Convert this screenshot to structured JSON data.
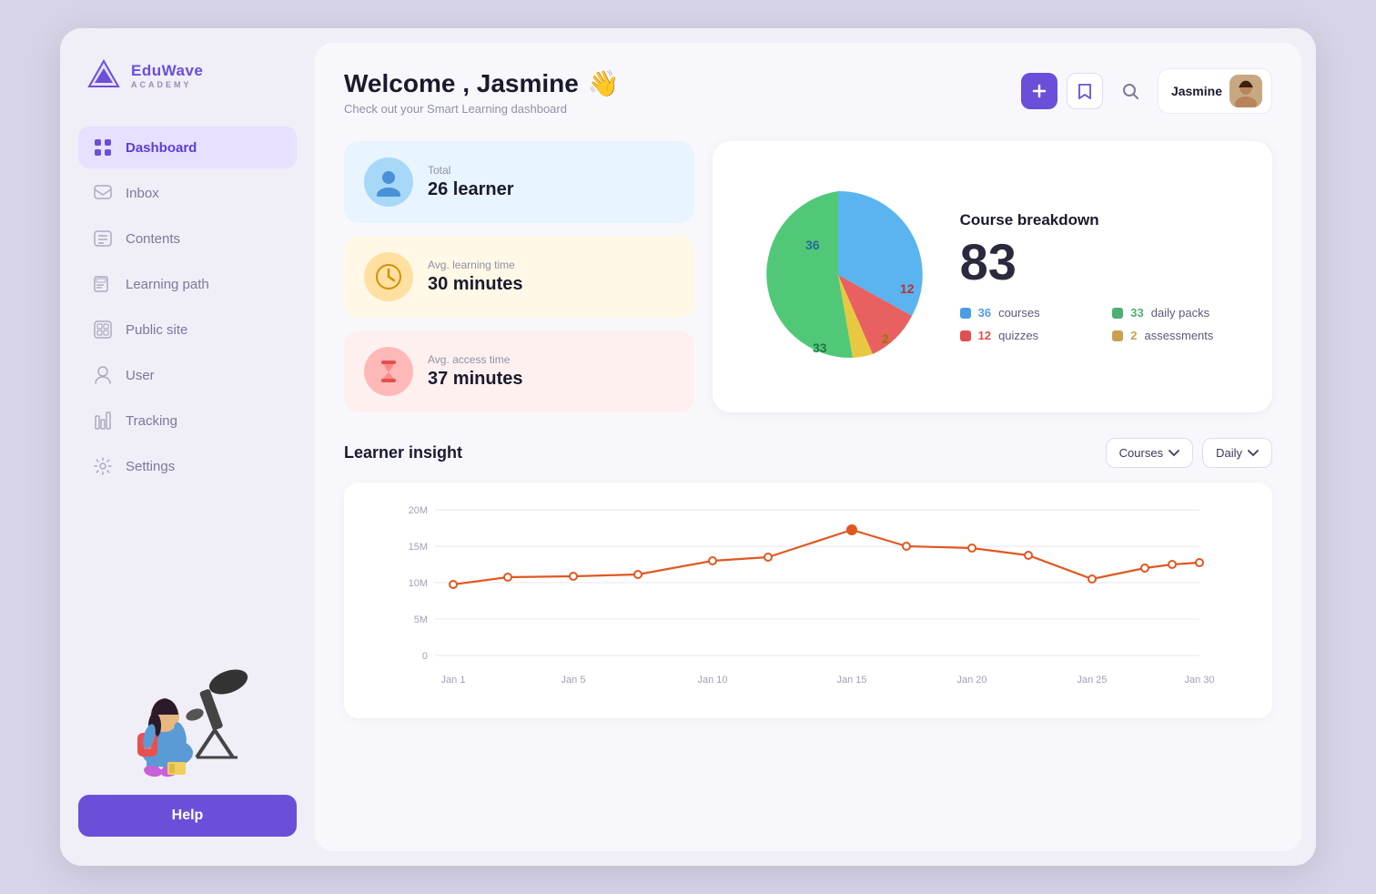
{
  "app": {
    "name": "EduWave",
    "subtitle": "ACADEMY"
  },
  "sidebar": {
    "nav_items": [
      {
        "id": "dashboard",
        "label": "Dashboard",
        "icon": "⊞",
        "active": true
      },
      {
        "id": "inbox",
        "label": "Inbox",
        "icon": "✉",
        "active": false
      },
      {
        "id": "contents",
        "label": "Contents",
        "icon": "☰",
        "active": false
      },
      {
        "id": "learning-path",
        "label": "Learning path",
        "icon": "📖",
        "active": false
      },
      {
        "id": "public-site",
        "label": "Public site",
        "icon": "⊡",
        "active": false
      },
      {
        "id": "user",
        "label": "User",
        "icon": "👤",
        "active": false
      },
      {
        "id": "tracking",
        "label": "Tracking",
        "icon": "📊",
        "active": false
      },
      {
        "id": "settings",
        "label": "Settings",
        "icon": "⚙",
        "active": false
      }
    ],
    "help_button": "Help"
  },
  "header": {
    "welcome": "Welcome , Jasmine",
    "welcome_emoji": "👋",
    "subtitle": "Check out your Smart Learning dashboard",
    "user_name": "Jasmine"
  },
  "stats": [
    {
      "label": "Total",
      "value": "26 learner",
      "color": "blue"
    },
    {
      "label": "Avg. learning time",
      "value": "30 minutes",
      "color": "yellow"
    },
    {
      "label": "Avg. access time",
      "value": "37 minutes",
      "color": "pink"
    }
  ],
  "breakdown": {
    "title": "Course breakdown",
    "total": "83",
    "legend": [
      {
        "label": "courses",
        "count": "36",
        "color": "#4b9de8"
      },
      {
        "label": "daily packs",
        "count": "33",
        "color": "#4caf74"
      },
      {
        "label": "quizzes",
        "count": "12",
        "color": "#e05050"
      },
      {
        "label": "assessments",
        "count": "2",
        "color": "#c8a050"
      }
    ],
    "pie": {
      "segments": [
        {
          "value": 36,
          "color": "#5ab4f0",
          "label": "36"
        },
        {
          "value": 12,
          "color": "#e86060",
          "label": "12"
        },
        {
          "value": 2,
          "color": "#e8c840",
          "label": "2"
        },
        {
          "value": 33,
          "color": "#50c878",
          "label": "33"
        }
      ]
    }
  },
  "learner_insight": {
    "title": "Learner insight",
    "filter_options": [
      "Courses",
      "Daily"
    ],
    "chart": {
      "y_labels": [
        "20M",
        "15M",
        "10M",
        "5M",
        "0"
      ],
      "x_labels": [
        "Jan 1",
        "Jan 5",
        "Jan 10",
        "Jan 15",
        "Jan 20",
        "Jan 25",
        "Jan 30"
      ],
      "data_points": [
        {
          "x": 0,
          "y": 9.8
        },
        {
          "x": 1,
          "y": 10.8
        },
        {
          "x": 2,
          "y": 10.9
        },
        {
          "x": 3,
          "y": 11.2
        },
        {
          "x": 4,
          "y": 13.0
        },
        {
          "x": 5,
          "y": 13.4
        },
        {
          "x": 6,
          "y": 17.5
        },
        {
          "x": 7,
          "y": 15.0
        },
        {
          "x": 8,
          "y": 14.8
        },
        {
          "x": 9,
          "y": 13.8
        },
        {
          "x": 10,
          "y": 10.5
        },
        {
          "x": 11,
          "y": 13.2
        },
        {
          "x": 12,
          "y": 13.5
        },
        {
          "x": 13,
          "y": 14.0
        }
      ]
    }
  }
}
